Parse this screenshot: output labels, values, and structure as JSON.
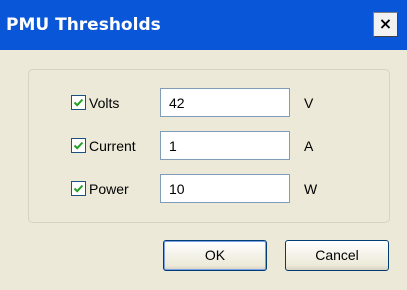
{
  "window": {
    "title": "PMU Thresholds",
    "close_glyph": "×",
    "titlebar_color": "#0a56d8"
  },
  "fields": [
    {
      "label": "Volts",
      "checked": true,
      "value": "42",
      "unit": "V"
    },
    {
      "label": "Current",
      "checked": true,
      "value": "1",
      "unit": "A"
    },
    {
      "label": "Power",
      "checked": true,
      "value": "10",
      "unit": "W"
    }
  ],
  "buttons": {
    "ok_label": "OK",
    "cancel_label": "Cancel"
  },
  "icons": {
    "close": "close-icon",
    "check": "checkmark-icon"
  }
}
